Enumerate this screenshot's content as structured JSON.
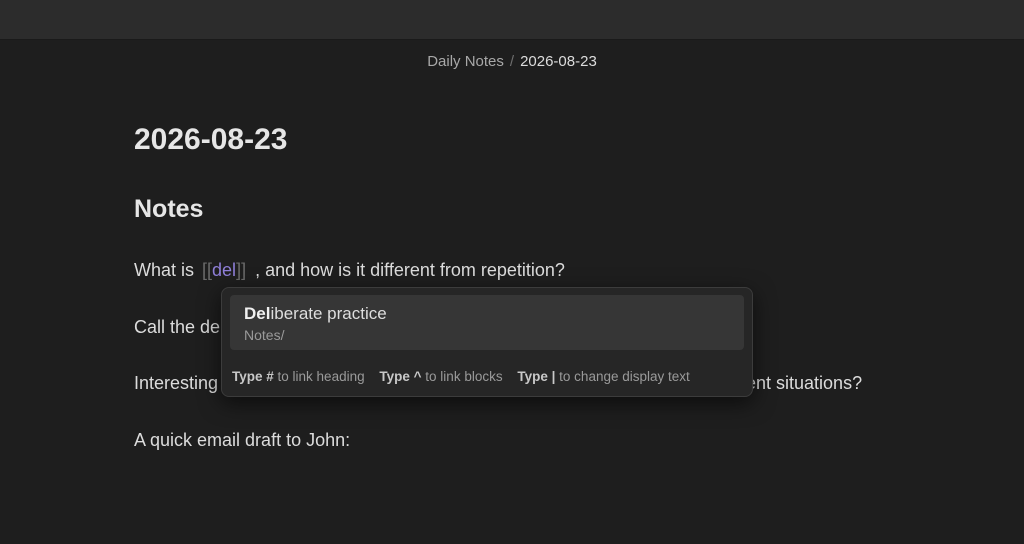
{
  "breadcrumb": {
    "folder": "Daily Notes",
    "separator": "/",
    "current": "2026-08-23"
  },
  "document": {
    "title": "2026-08-23",
    "section_heading": "Notes",
    "paragraphs": {
      "p1_before": "What is",
      "p1_open_bracket": "[[",
      "p1_link_text": "del",
      "p1_close_bracket": "]]",
      "p1_after": ", and how is it different from repetition?",
      "p2": "Call the de",
      "p3_start": "Interesting",
      "p3_end": "ent situations?",
      "p4": "A quick email draft to John:"
    }
  },
  "link_suggest": {
    "items": [
      {
        "match": "Del",
        "rest": "iberate practice",
        "path": "Notes/"
      }
    ],
    "hints": [
      {
        "key": "Type #",
        "text": "to link heading"
      },
      {
        "key": "Type ^",
        "text": "to link blocks"
      },
      {
        "key": "Type |",
        "text": "to change display text"
      }
    ]
  },
  "colors": {
    "background": "#1e1e1e",
    "topbar": "#2c2c2c",
    "link_accent": "#8f7fd8",
    "popup_bg": "#262626",
    "selected_item_bg": "#363636"
  }
}
